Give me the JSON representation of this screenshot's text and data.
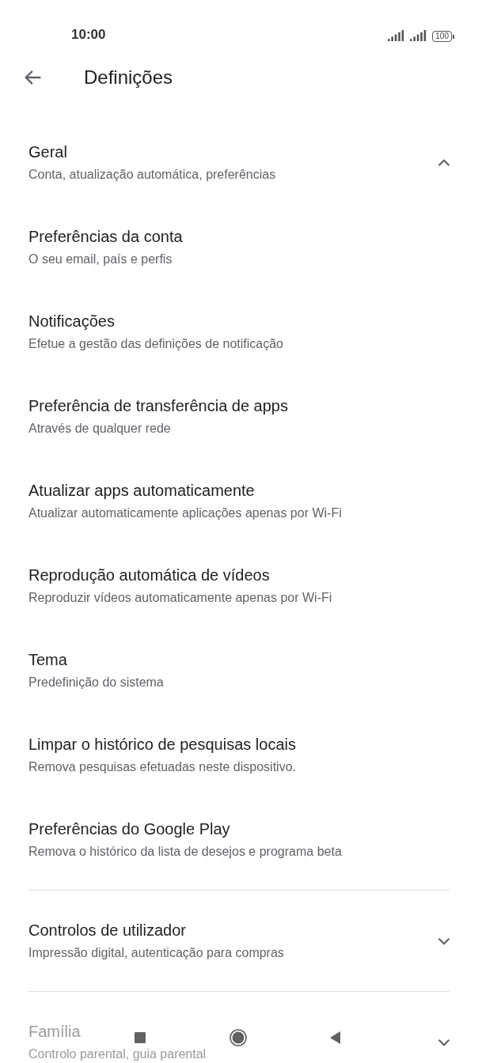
{
  "status_bar": {
    "time": "10:00",
    "battery": "100"
  },
  "header": {
    "title": "Definições"
  },
  "sections": [
    {
      "title": "Geral",
      "subtitle": "Conta, atualização automática, preferências",
      "expanded": true,
      "items": [
        {
          "title": "Preferências da conta",
          "subtitle": "O seu email, país e perfis"
        },
        {
          "title": "Notificações",
          "subtitle": "Efetue a gestão das definições de notificação"
        },
        {
          "title": "Preferência de transferência de apps",
          "subtitle": "Através de qualquer rede"
        },
        {
          "title": "Atualizar apps automaticamente",
          "subtitle": "Atualizar automaticamente aplicações apenas por Wi-Fi"
        },
        {
          "title": "Reprodução automática de vídeos",
          "subtitle": "Reproduzir vídeos automaticamente apenas por Wi-Fi"
        },
        {
          "title": "Tema",
          "subtitle": "Predefinição do sistema"
        },
        {
          "title": "Limpar o histórico de pesquisas locais",
          "subtitle": "Remova pesquisas efetuadas neste dispositivo."
        },
        {
          "title": "Preferências do Google Play",
          "subtitle": "Remova o histórico da lista de desejos e programa beta"
        }
      ]
    },
    {
      "title": "Controlos de utilizador",
      "subtitle": "Impressão digital, autenticação para compras",
      "expanded": false
    },
    {
      "title": "Família",
      "subtitle": "Controlo parental, guia parental",
      "expanded": false
    }
  ]
}
